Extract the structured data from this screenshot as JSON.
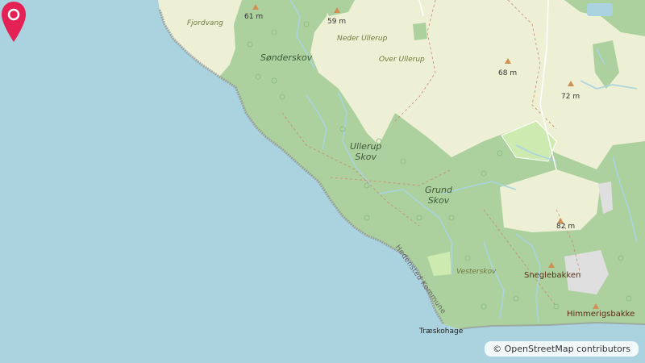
{
  "map": {
    "colors": {
      "sea": "#aad3df",
      "farmland": "#eef0d5",
      "forest": "#add19e",
      "meadow": "#cdebb0",
      "stream": "#aad3df",
      "peak": "#d08f55",
      "marker": "#e32154"
    },
    "labels": {
      "fjordvang": "Fjordvang",
      "elev_61": "61 m",
      "elev_59": "59 m",
      "neder_ullerup": "Neder Ullerup",
      "over_ullerup": "Over Ullerup",
      "elev_68": "68 m",
      "elev_72": "72 m",
      "sonderskov": "Sønderskov",
      "ullerup_skov_line1": "Ullerup",
      "ullerup_skov_line2": "Skov",
      "grund_skov_line1": "Grund",
      "grund_skov_line2": "Skov",
      "elev_82": "82 m",
      "vesterskov": "Vesterskov",
      "sneglebakken": "Sneglebakken",
      "himmerigsbakke": "Himmerigsbakke",
      "traeskohage": "Træskohage",
      "hedensted_kommune": "Hedensted Kommune"
    },
    "peak_icon": "triangle-peak-icon",
    "marker_icon": "location-pin-icon"
  },
  "attribution": {
    "prefix": "©",
    "text": "OpenStreetMap contributors"
  }
}
